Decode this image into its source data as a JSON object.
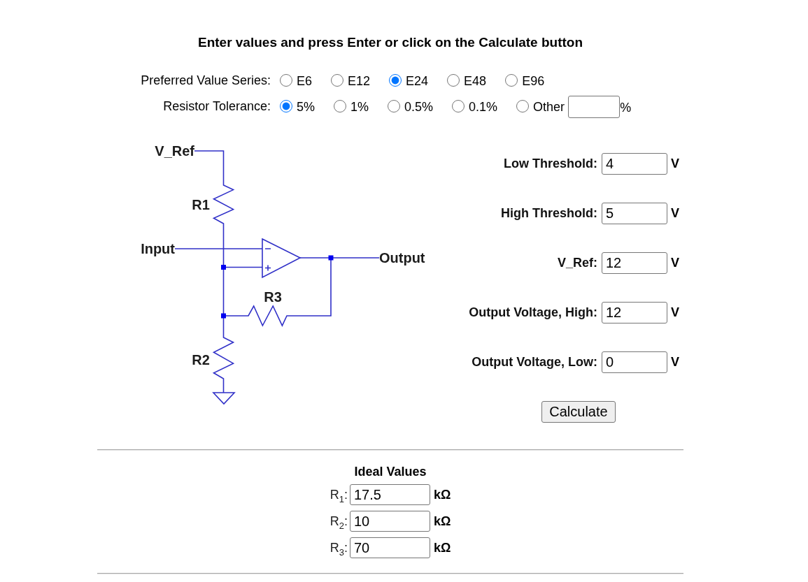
{
  "heading": "Enter values and press Enter or click on the Calculate button",
  "series": {
    "label": "Preferred Value Series:",
    "options": [
      {
        "label": "E6",
        "selected": false
      },
      {
        "label": "E12",
        "selected": false
      },
      {
        "label": "E24",
        "selected": true
      },
      {
        "label": "E48",
        "selected": false
      },
      {
        "label": "E96",
        "selected": false
      }
    ]
  },
  "tolerance": {
    "label": "Resistor Tolerance:",
    "options": [
      {
        "label": "5%",
        "selected": true,
        "kind": "preset"
      },
      {
        "label": "1%",
        "selected": false,
        "kind": "preset"
      },
      {
        "label": "0.5%",
        "selected": false,
        "kind": "preset"
      },
      {
        "label": "0.1%",
        "selected": false,
        "kind": "preset"
      },
      {
        "label": "Other",
        "selected": false,
        "kind": "custom",
        "unit": "%"
      }
    ]
  },
  "schematic": {
    "reference_label": "V_Ref",
    "input_label": "Input",
    "output_label": "Output",
    "resistor_labels": [
      "R1",
      "R3",
      "R2"
    ]
  },
  "inputs": [
    {
      "label": "Low Threshold:",
      "value": "4",
      "unit": "V"
    },
    {
      "label": "High Threshold:",
      "value": "5",
      "unit": "V"
    },
    {
      "label": "V_Ref:",
      "value": "12",
      "unit": "V"
    },
    {
      "label": "Output Voltage, High:",
      "value": "12",
      "unit": "V"
    },
    {
      "label": "Output Voltage, Low:",
      "value": "0",
      "unit": "V"
    }
  ],
  "calculate_button": "Calculate",
  "ideal_values": {
    "title": "Ideal Values",
    "rows": [
      {
        "label": "R$_{1}$:",
        "value": "17.5",
        "unit": "kΩ"
      },
      {
        "label": "R$_{2}$:",
        "value": "10",
        "unit": "kΩ"
      },
      {
        "label": "R$_{3}$:",
        "value": "70",
        "unit": "kΩ"
      }
    ]
  }
}
